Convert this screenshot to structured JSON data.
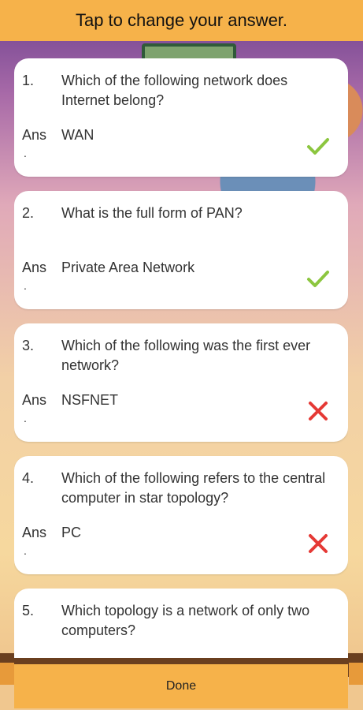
{
  "header": {
    "title": "Tap to change your answer."
  },
  "questions": [
    {
      "num": "1.",
      "text": "Which of the following network does Internet belong?",
      "ans_label": "Ans",
      "answer": "WAN",
      "dot": ".",
      "result": "correct"
    },
    {
      "num": "2.",
      "text": "What is the full form of PAN?",
      "ans_label": "Ans",
      "answer": "Private Area Network",
      "dot": ".",
      "result": "correct"
    },
    {
      "num": "3.",
      "text": "Which of the following was the first ever network?",
      "ans_label": "Ans",
      "answer": "NSFNET",
      "dot": ".",
      "result": "wrong"
    },
    {
      "num": "4.",
      "text": "Which of the following refers to the central computer in star topology?",
      "ans_label": "Ans",
      "answer": "PC",
      "dot": ".",
      "result": "wrong"
    },
    {
      "num": "5.",
      "text": "Which topology is a network of only two computers?",
      "ans_label": "",
      "answer": "",
      "dot": "",
      "result": ""
    }
  ],
  "footer": {
    "done_label": "Done"
  },
  "colors": {
    "accent": "#f6b24a",
    "correct": "#8cc63f",
    "wrong": "#e53935"
  },
  "icons": {
    "correct": "check-icon",
    "wrong": "cross-icon"
  }
}
